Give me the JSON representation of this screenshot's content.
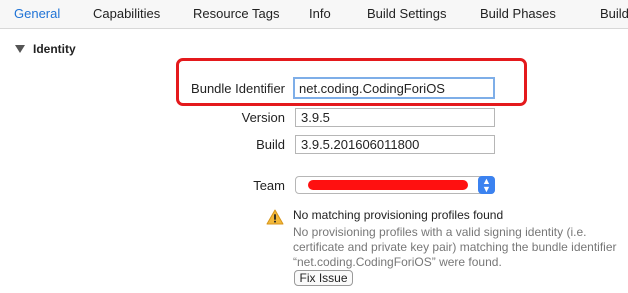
{
  "tabs": [
    {
      "label": "General",
      "active": true
    },
    {
      "label": "Capabilities"
    },
    {
      "label": "Resource Tags"
    },
    {
      "label": "Info"
    },
    {
      "label": "Build Settings"
    },
    {
      "label": "Build Phases"
    },
    {
      "label": "Build Ru"
    }
  ],
  "identity": {
    "section_title": "Identity",
    "bundle_identifier_label": "Bundle Identifier",
    "bundle_identifier_value": "net.coding.CodingForiOS",
    "version_label": "Version",
    "version_value": "3.9.5",
    "build_label": "Build",
    "build_value": "3.9.5.201606011800",
    "team_label": "Team"
  },
  "warning": {
    "title": "No matching provisioning profiles found",
    "body": "No provisioning profiles with a valid signing identity (i.e. certificate and private key pair) matching the bundle identifier “net.coding.CodingForiOS” were found.",
    "fix_button": "Fix Issue"
  },
  "colors": {
    "accent": "#1f73d6",
    "highlight_box": "#e4191c",
    "warning_icon": "#f2b83a"
  }
}
